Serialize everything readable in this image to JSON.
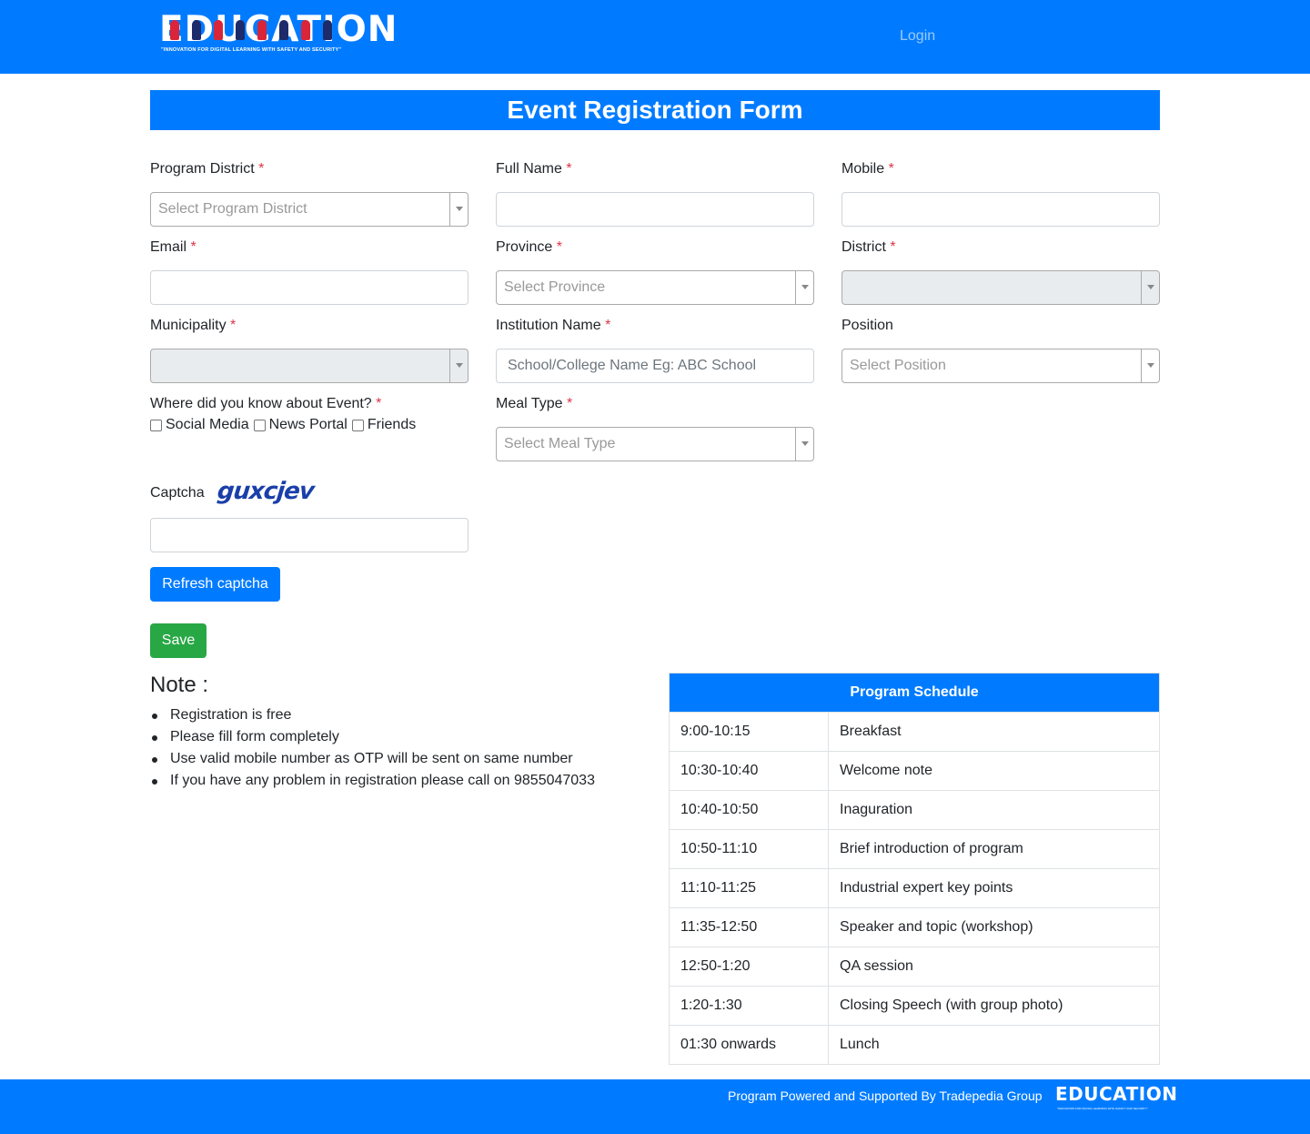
{
  "header": {
    "logo_text": "EDUCATION",
    "logo_tagline": "\"INNOVATION FOR DIGITAL LEARNING WITH SAFETY AND SECURITY\"",
    "login_label": "Login"
  },
  "page_title": "Event Registration Form",
  "required_mark": "*",
  "form": {
    "program_district": {
      "label": "Program District",
      "placeholder": "Select Program District"
    },
    "full_name": {
      "label": "Full Name",
      "value": ""
    },
    "mobile": {
      "label": "Mobile",
      "value": ""
    },
    "email": {
      "label": "Email",
      "value": ""
    },
    "province": {
      "label": "Province",
      "placeholder": "Select Province"
    },
    "district": {
      "label": "District",
      "value": ""
    },
    "municipality": {
      "label": "Municipality",
      "value": ""
    },
    "institution_name": {
      "label": "Institution Name",
      "placeholder": "School/College Name  Eg: ABC School"
    },
    "position": {
      "label": "Position",
      "placeholder": "Select Position"
    },
    "event_source": {
      "label": "Where did you know about Event?",
      "options": [
        "Social Media",
        "News Portal",
        "Friends"
      ]
    },
    "meal_type": {
      "label": "Meal Type",
      "placeholder": "Select Meal Type"
    },
    "captcha": {
      "label": "Captcha",
      "image_text": "guxcjev",
      "value": ""
    },
    "refresh_captcha_label": "Refresh captcha",
    "save_label": "Save"
  },
  "note": {
    "title": "Note :",
    "items": [
      "Registration is free",
      "Please fill form completely",
      "Use valid mobile number as OTP will be sent on same number",
      "If you have any problem in registration please call on 9855047033"
    ]
  },
  "schedule": {
    "title": "Program Schedule",
    "rows": [
      {
        "time": "9:00-10:15",
        "activity": "Breakfast"
      },
      {
        "time": "10:30-10:40",
        "activity": "Welcome note"
      },
      {
        "time": "10:40-10:50",
        "activity": "Inaguration"
      },
      {
        "time": "10:50-11:10",
        "activity": "Brief introduction of program"
      },
      {
        "time": "11:10-11:25",
        "activity": "Industrial expert key points"
      },
      {
        "time": "11:35-12:50",
        "activity": "Speaker and topic (workshop)"
      },
      {
        "time": "12:50-1:20",
        "activity": "QA session"
      },
      {
        "time": "1:20-1:30",
        "activity": "Closing Speech (with group photo)"
      },
      {
        "time": "01:30 onwards",
        "activity": "Lunch"
      }
    ]
  },
  "footer": {
    "text": "Program Powered and Supported By Tradepedia Group",
    "logo_text": "EDUCATION",
    "logo_tagline": "\"INNOVATION FOR DIGITAL LEARNING WITH SAFETY AND SECURITY\""
  },
  "colors": {
    "primary": "#007bff",
    "success": "#28a745",
    "required": "#dc3545"
  }
}
